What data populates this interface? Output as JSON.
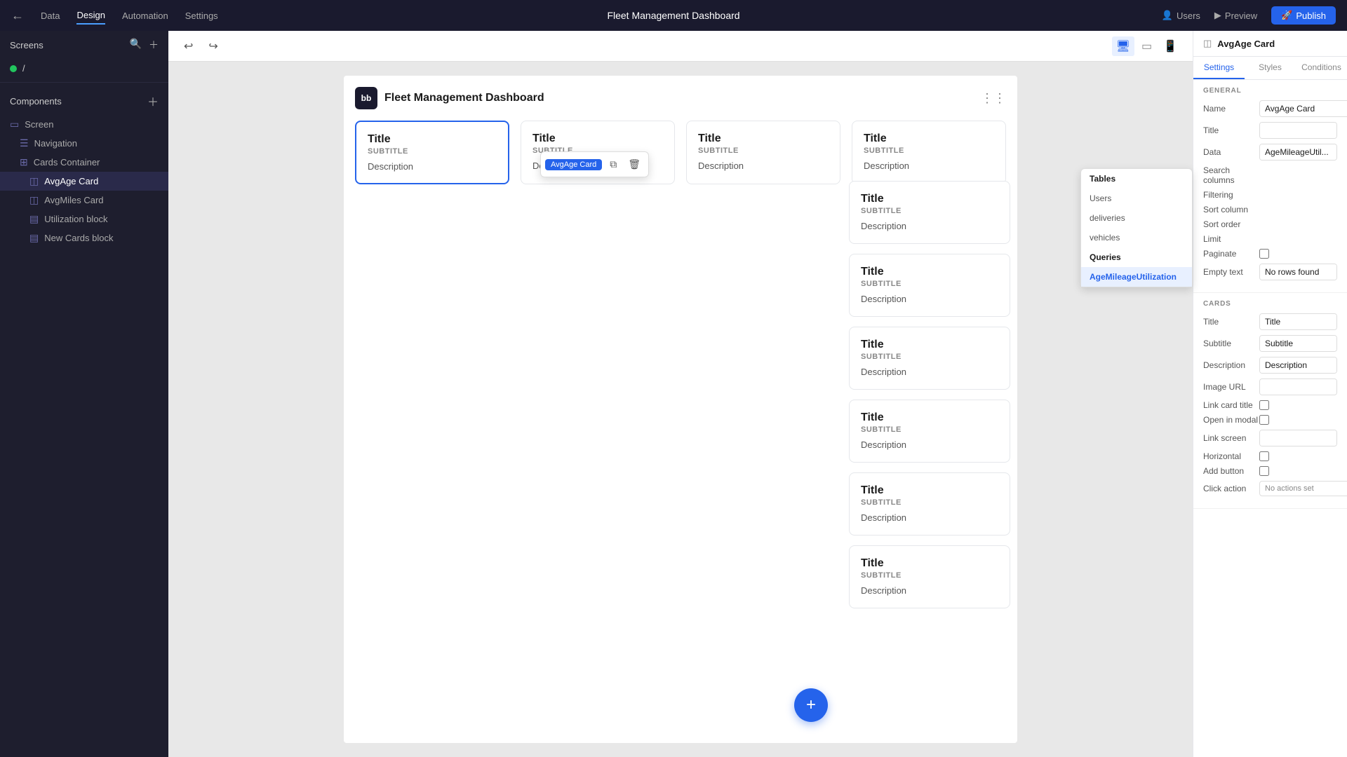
{
  "topNav": {
    "backIcon": "←",
    "items": [
      "Data",
      "Design",
      "Automation",
      "Settings"
    ],
    "activeItem": "Design",
    "title": "Fleet Management Dashboard",
    "rightActions": [
      {
        "label": "Users",
        "icon": "👤"
      },
      {
        "label": "Preview",
        "icon": "▶"
      },
      {
        "label": "Publish",
        "icon": "🚀"
      }
    ]
  },
  "leftSidebar": {
    "screensLabel": "Screens",
    "screenItem": "/",
    "componentsLabel": "Components",
    "components": [
      {
        "label": "Screen",
        "indent": 0
      },
      {
        "label": "Navigation",
        "indent": 0
      },
      {
        "label": "Cards Container",
        "indent": 0
      },
      {
        "label": "AvgAge Card",
        "indent": 1,
        "active": true
      },
      {
        "label": "AvgMiles Card",
        "indent": 1
      },
      {
        "label": "Utilization block",
        "indent": 1
      },
      {
        "label": "New Cards block",
        "indent": 1
      }
    ]
  },
  "contextMenu": {
    "badge": "AvgAge Card",
    "copyIcon": "⧉",
    "deleteIcon": "🗑"
  },
  "canvas": {
    "frameTitle": "Fleet Management Dashboard",
    "logoText": "bb",
    "cards": [
      {
        "title": "Title",
        "subtitle": "SUBTITLE",
        "desc": "Description",
        "selected": true
      },
      {
        "title": "Title",
        "subtitle": "SUBTITLE",
        "desc": "Description",
        "selected": false
      },
      {
        "title": "Title",
        "subtitle": "SUBTITLE",
        "desc": "Description",
        "selected": false
      },
      {
        "title": "Title",
        "subtitle": "SUBTITLE",
        "desc": "Description",
        "selected": false
      }
    ],
    "rightCards": [
      {
        "title": "Title",
        "subtitle": "SUBTITLE",
        "desc": "Description"
      },
      {
        "title": "Title",
        "subtitle": "SUBTITLE",
        "desc": "Description"
      },
      {
        "title": "Title",
        "subtitle": "SUBTITLE",
        "desc": "Description"
      },
      {
        "title": "Title",
        "subtitle": "SUBTITLE",
        "desc": "Description"
      },
      {
        "title": "Title",
        "subtitle": "SUBTITLE",
        "desc": "Description"
      },
      {
        "title": "Title",
        "subtitle": "SUBTITLE",
        "desc": "Description"
      }
    ]
  },
  "rightPanel": {
    "headerTitle": "AvgAge Card",
    "tabs": [
      "Settings",
      "Styles",
      "Conditions"
    ],
    "activeTab": "Settings",
    "general": {
      "sectionLabel": "GENERAL",
      "nameLabel": "Name",
      "nameValue": "AvgAge Card",
      "titleLabel": "Title",
      "titleValue": "",
      "dataLabel": "Data",
      "dataValue": "AgeMileageUtil...",
      "searchColumnsLabel": "Search columns",
      "filteringLabel": "Filtering",
      "sortColumnLabel": "Sort column",
      "sortOrderLabel": "Sort order",
      "limitLabel": "Limit",
      "paginateLabel": "Paginate",
      "emptyTextLabel": "Empty text",
      "emptyTextValue": "No rows found"
    },
    "cards": {
      "sectionLabel": "CARDS",
      "titleLabel": "Title",
      "titleValue": "Title",
      "subtitleLabel": "Subtitle",
      "subtitleValue": "Subtitle",
      "descriptionLabel": "Description",
      "descriptionValue": "Description",
      "imageUrlLabel": "Image URL",
      "imageUrlValue": "",
      "linkCardTitleLabel": "Link card title",
      "openInModalLabel": "Open in modal",
      "linkScreenLabel": "Link screen",
      "linkScreenValue": "",
      "horizontalLabel": "Horizontal",
      "addButtonLabel": "Add button",
      "clickActionLabel": "Click action",
      "clickActionValue": "No actions set"
    }
  },
  "dropdown": {
    "title": "Tables",
    "items": [
      {
        "label": "Users"
      },
      {
        "label": "deliveries"
      },
      {
        "label": "vehicles"
      }
    ],
    "queriesTitle": "Queries",
    "queriesItem": "AgeMileageUtilization"
  }
}
